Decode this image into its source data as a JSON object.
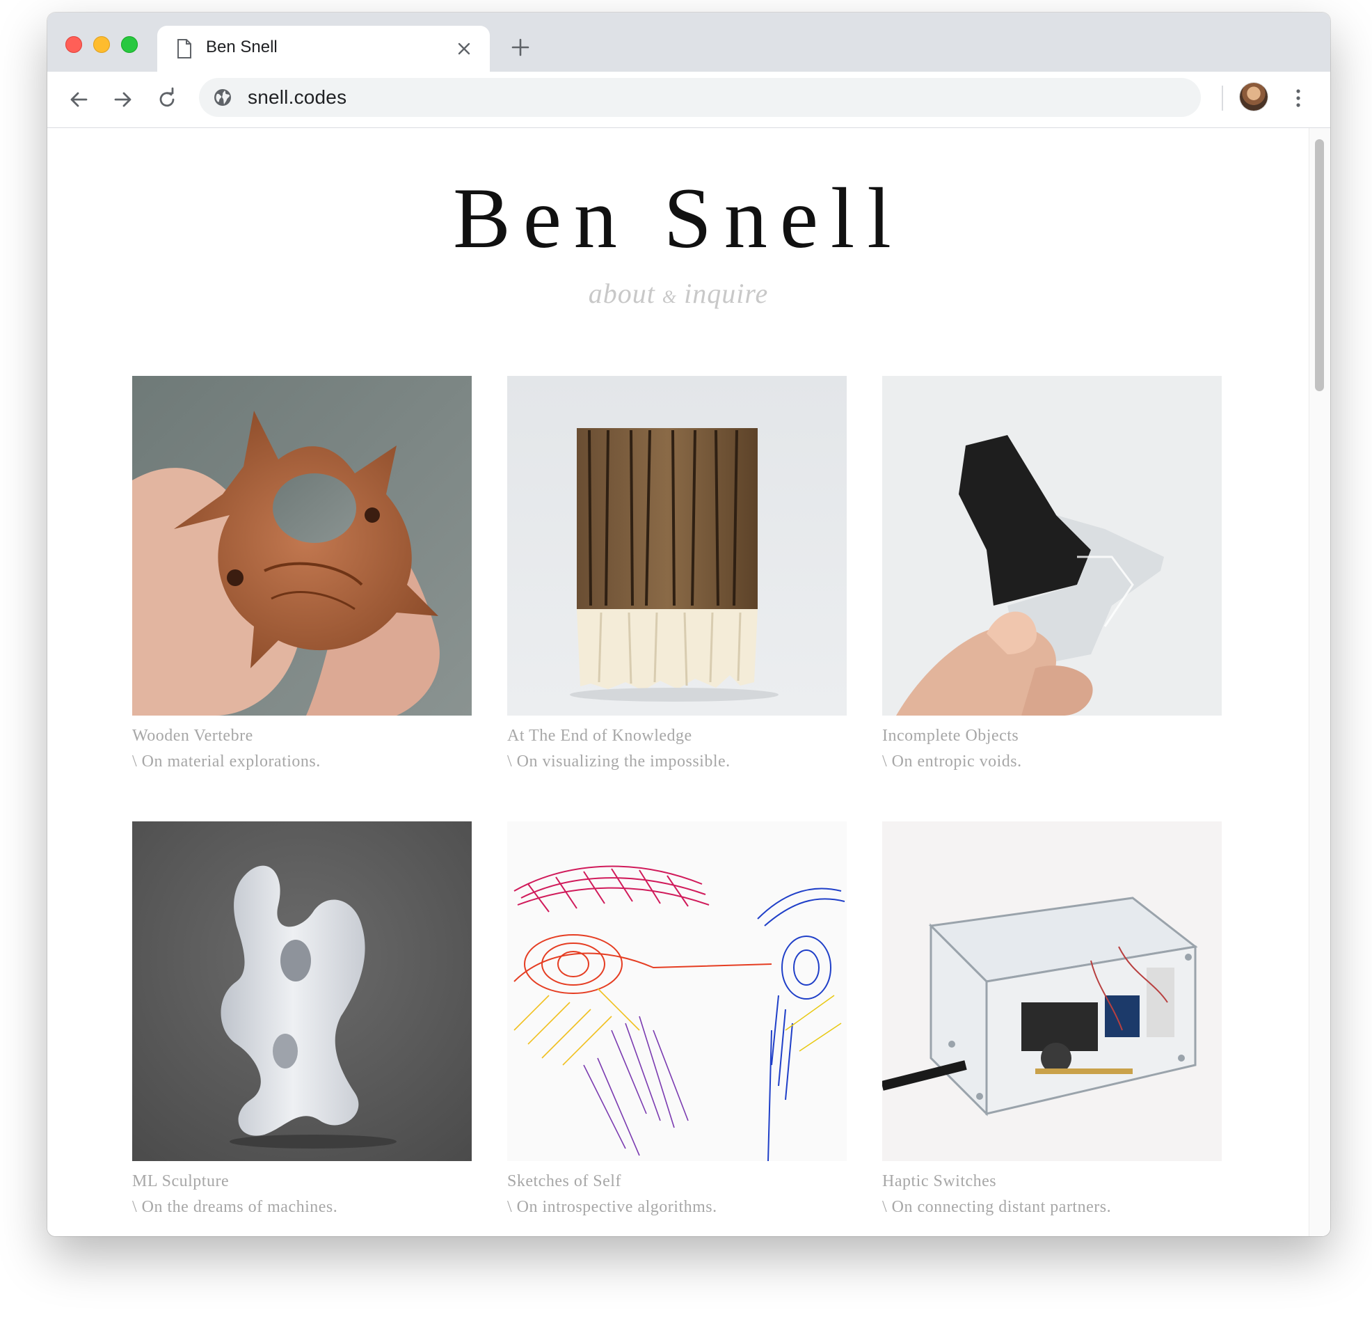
{
  "browser": {
    "tab_title": "Ben Snell",
    "url": "snell.codes"
  },
  "site": {
    "title": "Ben Snell",
    "about": "about",
    "amp": "&",
    "inquire": "inquire"
  },
  "projects": [
    {
      "title": "Wooden Vertebre",
      "desc": "\\ On material explorations."
    },
    {
      "title": "At The End of Knowledge",
      "desc": "\\ On visualizing the impossible."
    },
    {
      "title": "Incomplete Objects",
      "desc": "\\ On entropic voids."
    },
    {
      "title": "ML Sculpture",
      "desc": "\\ On the dreams of machines."
    },
    {
      "title": "Sketches of Self",
      "desc": "\\ On introspective algorithms."
    },
    {
      "title": "Haptic Switches",
      "desc": "\\ On connecting distant partners."
    }
  ],
  "colors": {
    "tabbar": "#dee1e6",
    "caption": "#a7a7a7",
    "subtitle": "#c8c8c8"
  }
}
